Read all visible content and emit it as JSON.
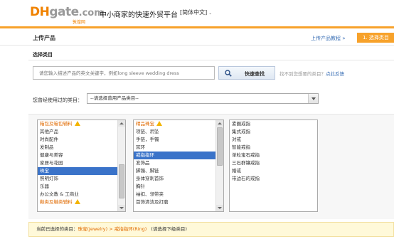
{
  "header": {
    "logo_dh": "DH",
    "logo_gate": "gate",
    "logo_com": ".com",
    "logo_cn": "敦煌网",
    "slogan": "中小商家的快速外贸平台",
    "language": "[简体中文]"
  },
  "title_bar": {
    "title": "上传产品",
    "tutorial_link": "上传产品教程 »",
    "step_label": "1. 选择类目"
  },
  "select_category": {
    "title": "选择类目",
    "search_placeholder": "请您输入描述产品的英文关键字，例如long sleeve wedding dress",
    "search_button": "快速查找",
    "not_found_text": "找不到您想要的类目？",
    "feedback_link": "点此反馈"
  },
  "used_category": {
    "label": "您曾经使用过的类目：",
    "selected": "--请选择曾用产品类目--"
  },
  "lists": {
    "level1": [
      {
        "label": "箱包及箱包辅料",
        "warn": true,
        "selected": false
      },
      {
        "label": "其他产品",
        "warn": false,
        "selected": false
      },
      {
        "label": "时尚配件",
        "warn": false,
        "selected": false
      },
      {
        "label": "发制品",
        "warn": false,
        "selected": false
      },
      {
        "label": "健康与美容",
        "warn": false,
        "selected": false
      },
      {
        "label": "家居与花园",
        "warn": false,
        "selected": false
      },
      {
        "label": "珠宝",
        "warn": false,
        "selected": true
      },
      {
        "label": "照明灯饰",
        "warn": false,
        "selected": false
      },
      {
        "label": "乐器",
        "warn": false,
        "selected": false
      },
      {
        "label": "办公文教 & 工商业",
        "warn": false,
        "selected": false
      },
      {
        "label": "鞋类及鞋类辅料",
        "warn": true,
        "selected": false
      }
    ],
    "level2": [
      {
        "label": "精品珠宝",
        "warn": true,
        "selected": false
      },
      {
        "label": "项链、吊坠",
        "warn": false,
        "selected": false
      },
      {
        "label": "手链，手镯",
        "warn": false,
        "selected": false
      },
      {
        "label": "耳环",
        "warn": false,
        "selected": false
      },
      {
        "label": "戒指指环",
        "warn": false,
        "selected": true
      },
      {
        "label": "发饰品",
        "warn": false,
        "selected": false
      },
      {
        "label": "脚镯、脚链",
        "warn": false,
        "selected": false
      },
      {
        "label": "身体穿刺首饰",
        "warn": false,
        "selected": false
      },
      {
        "label": "胸针",
        "warn": false,
        "selected": false
      },
      {
        "label": "袖扣、领带夹",
        "warn": false,
        "selected": false
      },
      {
        "label": "首饰清洁及打磨",
        "warn": false,
        "selected": false
      }
    ],
    "level3": [
      {
        "label": "素圈戒指",
        "warn": false,
        "selected": false
      },
      {
        "label": "集式戒指",
        "warn": false,
        "selected": false
      },
      {
        "label": "对戒",
        "warn": false,
        "selected": false
      },
      {
        "label": "智能戒指",
        "warn": false,
        "selected": false
      },
      {
        "label": "单粒宝石戒指",
        "warn": false,
        "selected": false
      },
      {
        "label": "三石群镶戒指",
        "warn": false,
        "selected": false
      },
      {
        "label": "婚戒",
        "warn": false,
        "selected": false
      },
      {
        "label": "带边石的戒指",
        "warn": false,
        "selected": false
      }
    ]
  },
  "current_selection": {
    "label": "当前已选择的类目：",
    "path": "珠宝(Jewelry) > 戒指指环(Ring)",
    "hint": "(请选择下级类目)"
  },
  "colors": {
    "brand_orange": "#f7a22b",
    "link_blue": "#3a6fb5",
    "selection_blue": "#3a73c9",
    "warn_orange": "#e06a00"
  }
}
